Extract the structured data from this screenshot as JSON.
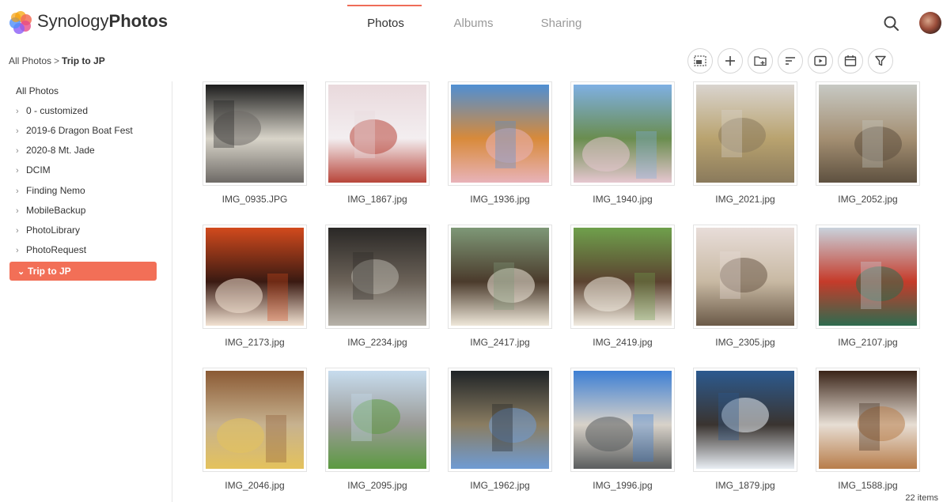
{
  "app": {
    "brand_regular": "Synology",
    "brand_bold": "Photos"
  },
  "tabs": [
    {
      "label": "Photos",
      "active": true
    },
    {
      "label": "Albums",
      "active": false
    },
    {
      "label": "Sharing",
      "active": false
    }
  ],
  "breadcrumb": {
    "parent": "All Photos",
    "separator": ">",
    "current": "Trip to JP"
  },
  "toolbar": {
    "buttons": [
      "select-icon",
      "add-icon",
      "create-folder-icon",
      "sort-icon",
      "slideshow-icon",
      "calendar-icon",
      "filter-icon"
    ]
  },
  "sidebar": {
    "root": "All Photos",
    "folders": [
      {
        "label": "0 - customized",
        "expanded": false,
        "active": false
      },
      {
        "label": "2019-6 Dragon Boat Fest",
        "expanded": false,
        "active": false
      },
      {
        "label": "2020-8 Mt. Jade",
        "expanded": false,
        "active": false
      },
      {
        "label": "DCIM",
        "expanded": false,
        "active": false
      },
      {
        "label": "Finding Nemo",
        "expanded": false,
        "active": false
      },
      {
        "label": "MobileBackup",
        "expanded": false,
        "active": false
      },
      {
        "label": "PhotoLibrary",
        "expanded": false,
        "active": false
      },
      {
        "label": "PhotoRequest",
        "expanded": false,
        "active": false
      },
      {
        "label": "Trip to JP",
        "expanded": true,
        "active": true
      }
    ]
  },
  "photos": [
    {
      "name": "IMG_0935.JPG",
      "colors": [
        "#1c1c1c",
        "#6e6a66",
        "#d8d4c9"
      ]
    },
    {
      "name": "IMG_1867.jpg",
      "colors": [
        "#e9d9dc",
        "#b8453a",
        "#f3eef0"
      ]
    },
    {
      "name": "IMG_1936.jpg",
      "colors": [
        "#4f8fd3",
        "#e8b3b9",
        "#d88a3a"
      ]
    },
    {
      "name": "IMG_1940.jpg",
      "colors": [
        "#7fb0e3",
        "#e6c7d0",
        "#6a8d4f"
      ]
    },
    {
      "name": "IMG_2021.jpg",
      "colors": [
        "#d9d4cf",
        "#8a7a5c",
        "#b9a36f"
      ]
    },
    {
      "name": "IMG_2052.jpg",
      "colors": [
        "#c7c9c4",
        "#5e5140",
        "#a48f72"
      ]
    },
    {
      "name": "IMG_2173.jpg",
      "colors": [
        "#d24a1d",
        "#f2e2d2",
        "#3a1a12"
      ]
    },
    {
      "name": "IMG_2234.jpg",
      "colors": [
        "#2a2826",
        "#b7b2a9",
        "#6b6258"
      ]
    },
    {
      "name": "IMG_2417.jpg",
      "colors": [
        "#7e9877",
        "#efe8da",
        "#4b3b2c"
      ]
    },
    {
      "name": "IMG_2419.jpg",
      "colors": [
        "#6fa04c",
        "#f2ece1",
        "#5b4230"
      ]
    },
    {
      "name": "IMG_2305.jpg",
      "colors": [
        "#e8ddd9",
        "#6b5a48",
        "#c8b9a3"
      ]
    },
    {
      "name": "IMG_2107.jpg",
      "colors": [
        "#c9d2dc",
        "#2e6b4f",
        "#c53b2a"
      ]
    },
    {
      "name": "IMG_2046.jpg",
      "colors": [
        "#8b5a34",
        "#e4c25c",
        "#c7b28f"
      ]
    },
    {
      "name": "IMG_2095.jpg",
      "colors": [
        "#c7dcee",
        "#5c9a41",
        "#9a9a96"
      ]
    },
    {
      "name": "IMG_1962.jpg",
      "colors": [
        "#1f2326",
        "#6f9bd3",
        "#8a7d62"
      ]
    },
    {
      "name": "IMG_1996.jpg",
      "colors": [
        "#3d7fd4",
        "#5a5d5e",
        "#d8d2c9"
      ]
    },
    {
      "name": "IMG_1879.jpg",
      "colors": [
        "#2c5a8f",
        "#e9eef4",
        "#3a3430"
      ]
    },
    {
      "name": "IMG_1588.jpg",
      "colors": [
        "#3a2418",
        "#b87d4a",
        "#e7ded4"
      ]
    }
  ],
  "status": {
    "count": "22 items"
  }
}
